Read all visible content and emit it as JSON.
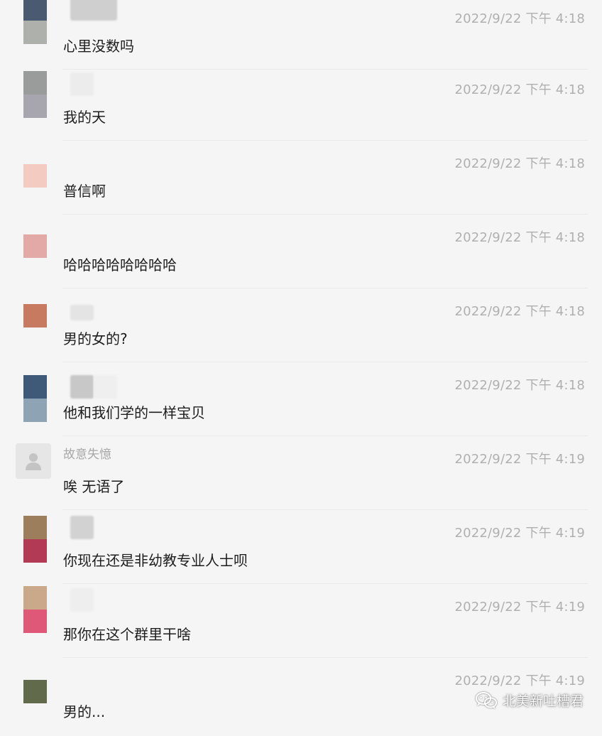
{
  "messages": [
    {
      "sender": "",
      "avatar_colors": [
        "#4a5a70",
        "#aeb0ac"
      ],
      "time": "2022/9/22 下午 4:18",
      "text": "心里没数吗"
    },
    {
      "sender": "",
      "avatar_colors": [
        "#9a9c9b",
        "#a7a6ae"
      ],
      "time": "2022/9/22 下午 4:18",
      "text": "我的天"
    },
    {
      "sender": "",
      "avatar_colors": [
        "#f3cbc0",
        "#f5f5f5"
      ],
      "time": "2022/9/22 下午 4:18",
      "text": "普信啊"
    },
    {
      "sender": "",
      "avatar_colors": [
        "#e2a9a7",
        "#f5f5f5"
      ],
      "time": "2022/9/22 下午 4:18",
      "text": "哈哈哈哈哈哈哈哈"
    },
    {
      "sender": "",
      "avatar_colors": [
        "#c77a5f",
        "#f5f5f5"
      ],
      "time": "2022/9/22 下午 4:18",
      "text": "男的女的?"
    },
    {
      "sender": "",
      "avatar_colors": [
        "#3e5a78",
        "#8ea4b5"
      ],
      "time": "2022/9/22 下午 4:18",
      "text": "他和我们学的一样宝贝"
    },
    {
      "sender": "故意失憶",
      "avatar_colors": [
        "#e6e6e6",
        "#e6e6e6"
      ],
      "time": "2022/9/22 下午 4:19",
      "text": "唉 无语了"
    },
    {
      "sender": "",
      "avatar_colors": [
        "#9c7e5c",
        "#b23a55"
      ],
      "time": "2022/9/22 下午 4:19",
      "text": "你现在还是非幼教专业人士呗"
    },
    {
      "sender": "",
      "avatar_colors": [
        "#c9a98a",
        "#e05878"
      ],
      "time": "2022/9/22 下午 4:19",
      "text": "那你在这个群里干啥"
    },
    {
      "sender": "",
      "avatar_colors": [
        "#626a4c",
        "#f5f5f5"
      ],
      "time": "2022/9/22 下午 4:19",
      "text": "男的..."
    }
  ],
  "watermark": {
    "text": "北美新吐槽君",
    "icon": "wechat-icon"
  }
}
